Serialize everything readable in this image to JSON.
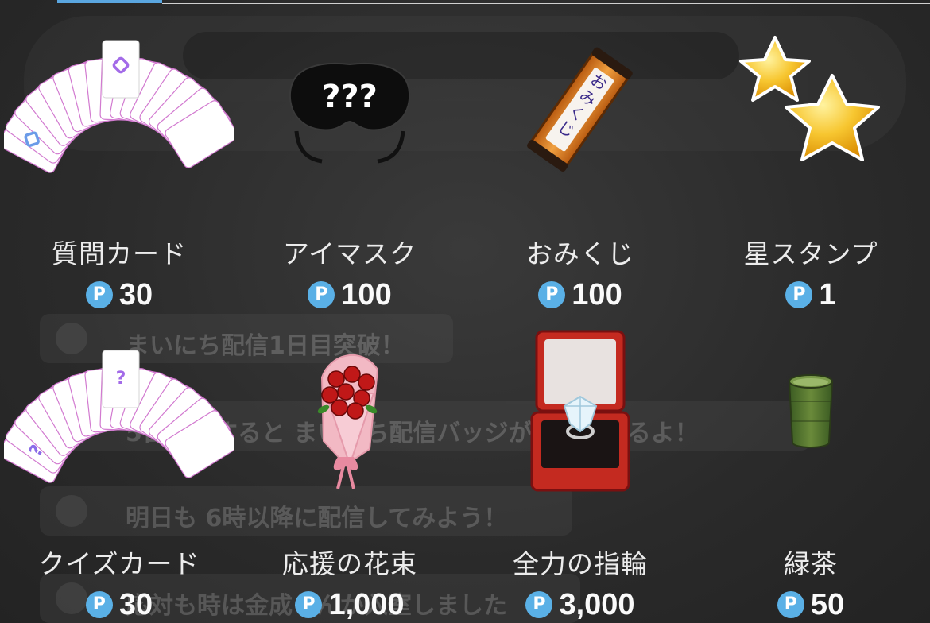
{
  "top_bar": {
    "active_tab_color": "#5aa6e0"
  },
  "currency_badge": "P",
  "items": [
    {
      "name": "質問カード",
      "price": "30",
      "icon": "question-card-deck-icon"
    },
    {
      "name": "アイマスク",
      "price": "100",
      "icon": "eye-mask-icon",
      "mask_text": "???"
    },
    {
      "name": "おみくじ",
      "price": "100",
      "icon": "omikuji-box-icon",
      "omikuji_text": "おみくじ"
    },
    {
      "name": "星スタンプ",
      "price": "1",
      "icon": "star-stamp-icon"
    },
    {
      "name": "クイズカード",
      "price": "30",
      "icon": "quiz-card-deck-icon"
    },
    {
      "name": "応援の花束",
      "price": "1,000",
      "icon": "flower-bouquet-icon"
    },
    {
      "name": "全力の指輪",
      "price": "3,000",
      "icon": "diamond-ring-box-icon"
    },
    {
      "name": "緑茶",
      "price": "50",
      "icon": "green-tea-cup-icon"
    }
  ],
  "background_chat": [
    "まいにち配信1日目突破！",
    "5日配信すると まいにち配信バッジが獲得できるよ！",
    "明日も 6時以降に配信してみよう！",
    "応対も時は金成さんが入室しました"
  ]
}
